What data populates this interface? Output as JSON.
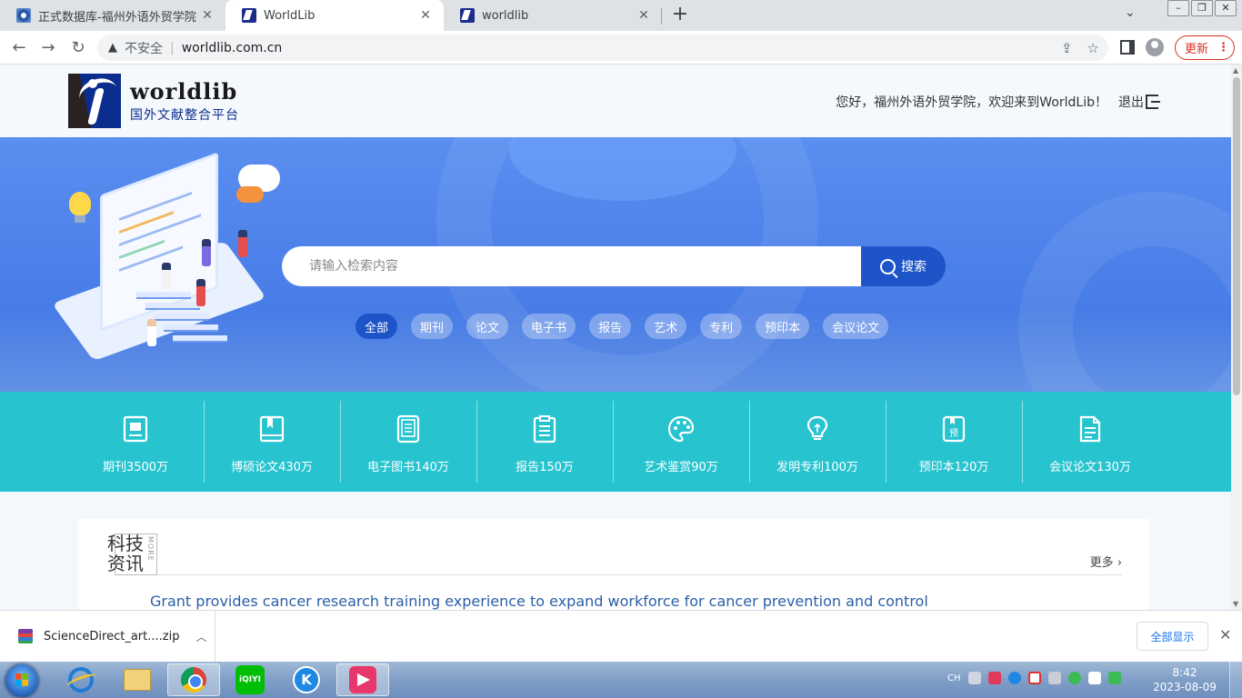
{
  "browser": {
    "tabs": [
      {
        "title": "正式数据库-福州外语外贸学院 图",
        "icon": "globe-icon"
      },
      {
        "title": "WorldLib",
        "icon": "worldlib-icon",
        "active": true
      },
      {
        "title": "worldlib",
        "icon": "worldlib-icon"
      }
    ],
    "new_tab": "+",
    "address": {
      "security": "不安全",
      "url": "worldlib.com.cn"
    },
    "update_label": "更新"
  },
  "site": {
    "logo_en": "worldlib",
    "logo_cn": "国外文献整合平台",
    "welcome": "您好，福州外语外贸学院，欢迎来到WorldLib！",
    "logout": "退出"
  },
  "search": {
    "placeholder": "请输入检索内容",
    "button": "搜索",
    "categories": [
      "全部",
      "期刊",
      "论文",
      "电子书",
      "报告",
      "艺术",
      "专利",
      "预印本",
      "会议论文"
    ],
    "active_category": "全部"
  },
  "stats": [
    {
      "label": "期刊3500万",
      "icon": "journal-icon"
    },
    {
      "label": "博硕论文430万",
      "icon": "book-icon"
    },
    {
      "label": "电子图书140万",
      "icon": "ebook-icon"
    },
    {
      "label": "报告150万",
      "icon": "report-icon"
    },
    {
      "label": "艺术鉴赏90万",
      "icon": "palette-icon"
    },
    {
      "label": "发明专利100万",
      "icon": "lightbulb-icon"
    },
    {
      "label": "预印本120万",
      "icon": "preprint-icon"
    },
    {
      "label": "会议论文130万",
      "icon": "document-icon"
    }
  ],
  "news": {
    "title_line1": "科技",
    "title_line2": "资讯",
    "tag": "MORE",
    "more": "更多",
    "items": [
      "Grant provides cancer research training experience to expand workforce for cancer prevention and control"
    ]
  },
  "downloads": {
    "file": "ScienceDirect_art....zip",
    "show_all": "全部显示"
  },
  "taskbar": {
    "apps": [
      "ie-icon",
      "explorer-icon",
      "chrome-icon",
      "iqiyi-icon",
      "kuwo-icon",
      "media-icon"
    ],
    "iqiyi_label": "iQIYI",
    "tray_lang": "CH",
    "time": "8:42",
    "date": "2023-08-09"
  }
}
